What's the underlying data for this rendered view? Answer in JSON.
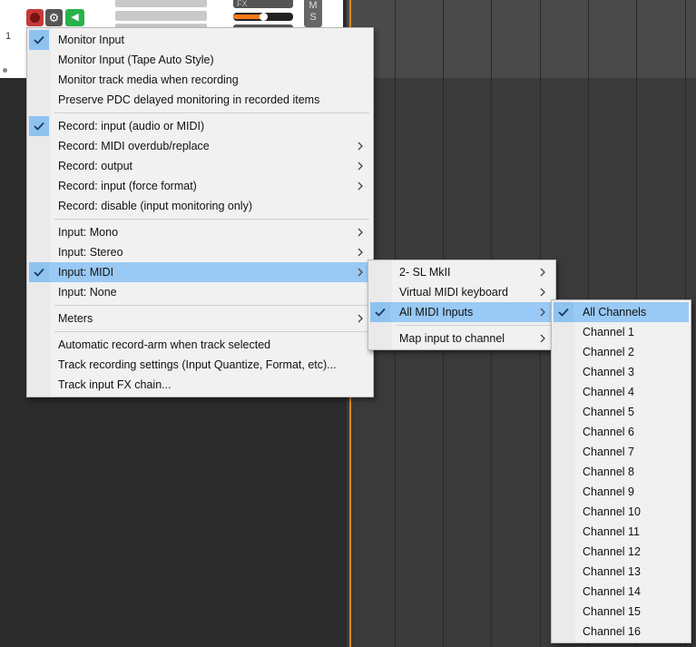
{
  "track": {
    "number": "1",
    "fx_label": "FX",
    "mute_label": "M",
    "solo_label": "S",
    "volume_level": 0.5
  },
  "colors": {
    "accent_select": "#99c9f5",
    "check_bg": "#8ec3f0",
    "record_red": "#c6393a",
    "monitor_green": "#27b24a",
    "play_cursor": "#d98a1e"
  },
  "main_menu": {
    "groups": [
      [
        {
          "label": "Monitor Input",
          "checked": true
        },
        {
          "label": "Monitor Input (Tape Auto Style)"
        },
        {
          "label": "Monitor track media when recording"
        },
        {
          "label": "Preserve PDC delayed monitoring in recorded items"
        }
      ],
      [
        {
          "label": "Record: input (audio or MIDI)",
          "checked": true
        },
        {
          "label": "Record: MIDI overdub/replace",
          "submenu": true
        },
        {
          "label": "Record: output",
          "submenu": true
        },
        {
          "label": "Record: input (force format)",
          "submenu": true
        },
        {
          "label": "Record: disable (input monitoring only)"
        }
      ],
      [
        {
          "label": "Input: Mono",
          "submenu": true
        },
        {
          "label": "Input: Stereo",
          "submenu": true
        },
        {
          "label": "Input: MIDI",
          "submenu": true,
          "checked": true,
          "highlighted": true
        },
        {
          "label": "Input: None"
        }
      ],
      [
        {
          "label": "Meters",
          "submenu": true
        }
      ],
      [
        {
          "label": "Automatic record-arm when track selected"
        },
        {
          "label": "Track recording settings (Input Quantize, Format, etc)..."
        },
        {
          "label": "Track input FX chain..."
        }
      ]
    ]
  },
  "midi_menu": {
    "groups": [
      [
        {
          "label": "2- SL MkII",
          "submenu": true
        },
        {
          "label": "Virtual MIDI keyboard",
          "submenu": true
        },
        {
          "label": "All MIDI Inputs",
          "submenu": true,
          "checked": true,
          "highlighted": true
        }
      ],
      [
        {
          "label": "Map input to channel",
          "submenu": true
        }
      ]
    ]
  },
  "channel_menu": {
    "groups": [
      [
        {
          "label": "All Channels",
          "checked": true,
          "highlighted": true
        },
        {
          "label": "Channel 1"
        },
        {
          "label": "Channel 2"
        },
        {
          "label": "Channel 3"
        },
        {
          "label": "Channel 4"
        },
        {
          "label": "Channel 5"
        },
        {
          "label": "Channel 6"
        },
        {
          "label": "Channel 7"
        },
        {
          "label": "Channel 8"
        },
        {
          "label": "Channel 9"
        },
        {
          "label": "Channel 10"
        },
        {
          "label": "Channel 11"
        },
        {
          "label": "Channel 12"
        },
        {
          "label": "Channel 13"
        },
        {
          "label": "Channel 14"
        },
        {
          "label": "Channel 15"
        },
        {
          "label": "Channel 16"
        }
      ]
    ]
  }
}
